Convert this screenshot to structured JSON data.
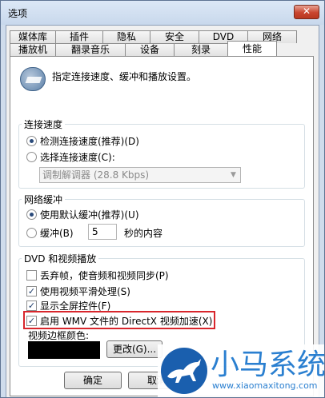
{
  "window": {
    "title": "选项",
    "close_label": "✕"
  },
  "tabs": {
    "top": [
      "媒体库",
      "插件",
      "隐私",
      "安全",
      "DVD",
      "网络"
    ],
    "bottom": [
      "播放机",
      "翻录音乐",
      "设备",
      "刻录",
      "性能"
    ],
    "active": "性能"
  },
  "header": {
    "text": "指定连接速度、缓冲和播放设置。",
    "icon": "performance-icon"
  },
  "connection": {
    "label": "连接速度",
    "detect": "检测连接速度(推荐)(D)",
    "choose": "选择连接速度(C):",
    "modem": "调制解调器 (28.8 Kbps)"
  },
  "buffer": {
    "label": "网络缓冲",
    "default": "使用默认缓冲(推荐)(U)",
    "custom": "缓冲(B)",
    "seconds": "5",
    "suffix": "秒的内容"
  },
  "video": {
    "label": "DVD 和视频播放",
    "drop_frames": "丢弃帧，使音频和视频同步(P)",
    "smoothing": "使用视频平滑处理(S)",
    "fullscreen": "显示全屏控件(F)",
    "directx": "启用 WMV 文件的 DirectX 视频加速(X)",
    "border_color": "视频边框颜色:",
    "change": "更改(G)..."
  },
  "footer": {
    "ok": "确定",
    "cancel": "取消"
  },
  "watermark": {
    "brand": "小马系统",
    "url": "www.xiaomaxitong.com"
  },
  "colors": {
    "highlight": "#d8262c",
    "swatch": "#000000",
    "watermark": "#2a7fd0"
  }
}
